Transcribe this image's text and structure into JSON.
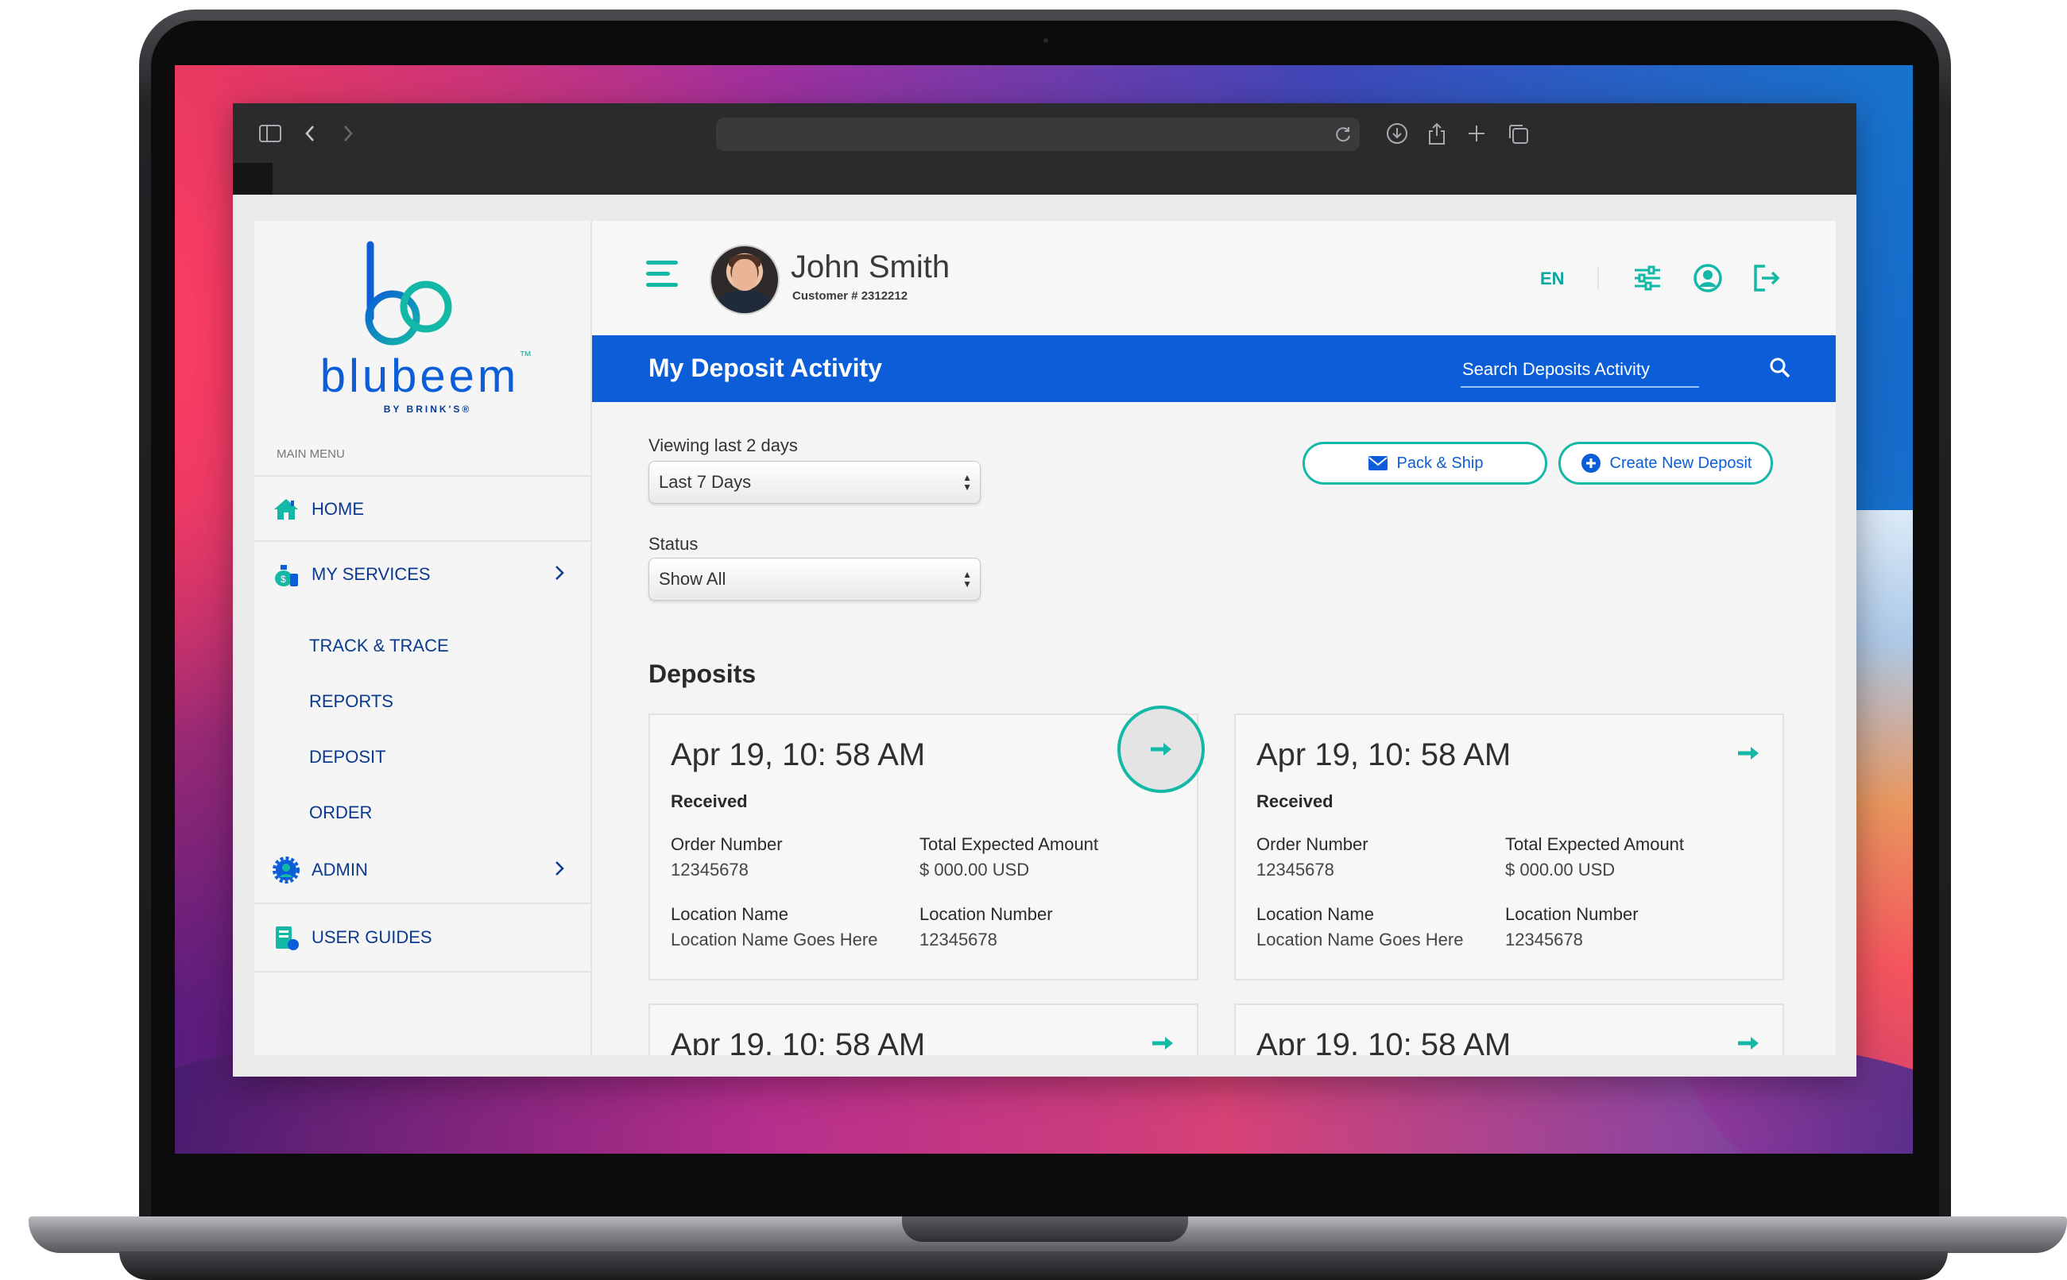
{
  "browser": {
    "nav_icons": [
      "sidebar-toggle-icon",
      "back-icon",
      "forward-icon"
    ],
    "right_icons": [
      "reload-icon",
      "download-icon",
      "share-icon",
      "new-tab-icon",
      "tabs-overview-icon"
    ]
  },
  "brand": {
    "name": "blubeem",
    "trademark": "™",
    "byline": "BY BRINK'S®",
    "colors": {
      "primary": "#0b5ed7",
      "accent": "#14b8a6",
      "navy": "#0a3a8e"
    }
  },
  "sidebar": {
    "main_menu_label": "MAIN MENU",
    "items": [
      {
        "label": "HOME",
        "icon": "home-icon"
      },
      {
        "label": "MY SERVICES",
        "icon": "money-bag-icon"
      },
      {
        "label": "ADMIN",
        "icon": "gear-user-icon"
      },
      {
        "label": "USER GUIDES",
        "icon": "guide-book-icon"
      }
    ],
    "submenu": [
      "TRACK & TRACE",
      "REPORTS",
      "DEPOSIT",
      "ORDER"
    ]
  },
  "header": {
    "user_name": "John Smith",
    "customer_number": "Customer # 2312212",
    "language": "EN",
    "icons": [
      "filters-icon",
      "user-profile-icon",
      "logout-icon"
    ]
  },
  "titlebar": {
    "title": "My Deposit Activity",
    "search_placeholder": "Search Deposits Activity"
  },
  "filters": {
    "range_label": "Viewing last 2 days",
    "range_value": "Last 7 Days",
    "status_label": "Status",
    "status_value": "Show All"
  },
  "actions": {
    "pack_ship": "Pack & Ship",
    "create_deposit": "Create New Deposit"
  },
  "deposits": {
    "title": "Deposits",
    "cards": [
      {
        "date": "Apr 19, 10: 58 AM",
        "status": "Received",
        "order_label": "Order Number",
        "order_value": "12345678",
        "amount_label": "Total Expected Amount",
        "amount_value": "$ 000.00 USD",
        "location_name_label": "Location Name",
        "location_name_value": "Location Name Goes Here",
        "location_number_label": "Location Number",
        "location_number_value": "12345678"
      },
      {
        "date": "Apr 19, 10: 58 AM",
        "status": "Received",
        "order_label": "Order Number",
        "order_value": "12345678",
        "amount_label": "Total Expected Amount",
        "amount_value": "$ 000.00 USD",
        "location_name_label": "Location Name",
        "location_name_value": "Location Name Goes Here",
        "location_number_label": "Location Number",
        "location_number_value": "12345678"
      },
      {
        "date": "Apr 19, 10: 58 AM"
      },
      {
        "date": "Apr 19, 10: 58 AM"
      }
    ]
  }
}
